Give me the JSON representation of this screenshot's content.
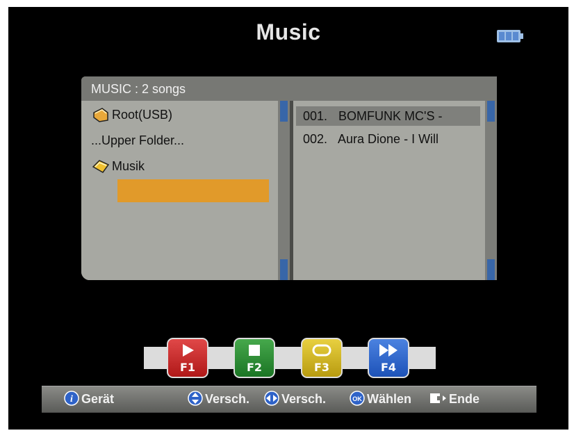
{
  "screen": {
    "title": "Music",
    "battery_icon": "battery-icon"
  },
  "browser": {
    "header": "MUSIC :   2 songs",
    "folders": [
      {
        "label": "Root(USB)",
        "icon": "folder-icon"
      },
      {
        "label": "...Upper Folder..."
      },
      {
        "label": "Musik",
        "icon": "folder-icon",
        "selected": true
      }
    ],
    "songs": [
      {
        "number": "001.",
        "title": "BOMFUNK MC'S -",
        "selected": true
      },
      {
        "number": "002.",
        "title": "Aura Dione - I Will"
      }
    ]
  },
  "function_keys": [
    {
      "label": "F1",
      "icon": "play-icon",
      "color": "#c62a2a"
    },
    {
      "label": "F2",
      "icon": "stop-icon",
      "color": "#2a8a33"
    },
    {
      "label": "F3",
      "icon": "repeat-icon",
      "color": "#cfb520"
    },
    {
      "label": "F4",
      "icon": "fast-forward-icon",
      "color": "#2d66cc"
    }
  ],
  "help_bar": [
    {
      "icon": "info-icon",
      "label": "Gerät"
    },
    {
      "icon": "up-down-arrows-icon",
      "label": "Versch."
    },
    {
      "icon": "left-right-arrows-icon",
      "label": "Versch."
    },
    {
      "icon": "ok-icon",
      "label": "Wählen"
    },
    {
      "icon": "exit-icon",
      "label": "Ende"
    }
  ],
  "colors": {
    "background": "#000000",
    "panel": "#a7a8a2",
    "header": "#777874",
    "folder_highlight": "#e19a2a",
    "song_highlight": "#7f807c",
    "scrollbar_thumb": "#3866a8"
  }
}
